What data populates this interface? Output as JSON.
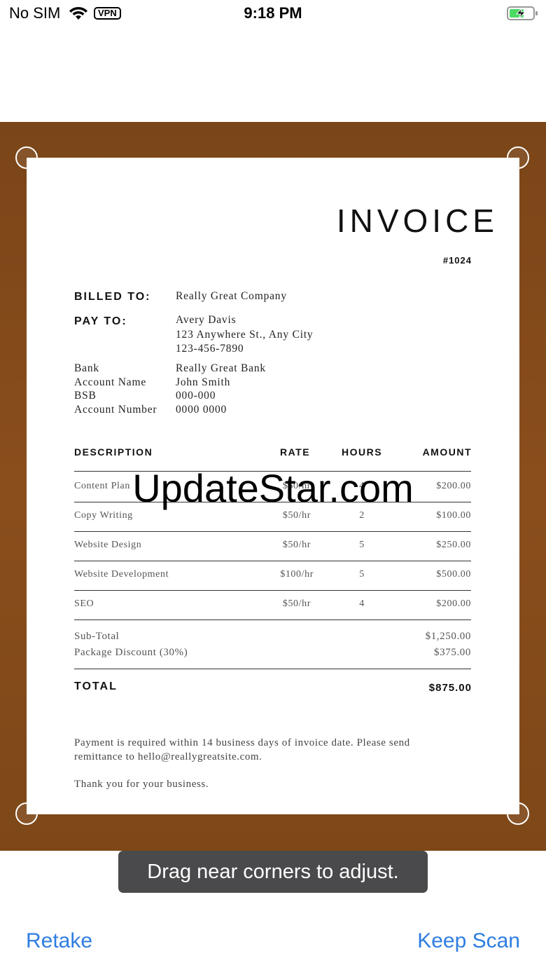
{
  "status_bar": {
    "carrier": "No SIM",
    "vpn": "VPN",
    "time": "9:18 PM",
    "battery_icon": "battery-charging-icon",
    "wifi_icon": "wifi-icon"
  },
  "invoice": {
    "title": "INVOICE",
    "number": "#1024",
    "billed_to_label": "BILLED TO:",
    "billed_to_value": "Really Great Company",
    "pay_to_label": "PAY TO:",
    "pay_to_name": "Avery Davis",
    "pay_to_address": "123 Anywhere St., Any City",
    "pay_to_phone": "123-456-7890",
    "bank_fields": [
      {
        "label": "Bank",
        "value": "Really Great Bank"
      },
      {
        "label": "Account Name",
        "value": "John Smith"
      },
      {
        "label": "BSB",
        "value": "000-000"
      },
      {
        "label": "Account Number",
        "value": "0000 0000"
      }
    ],
    "columns": [
      "DESCRIPTION",
      "RATE",
      "HOURS",
      "AMOUNT"
    ],
    "rows": [
      {
        "description": "Content Plan",
        "rate": "$50/hr",
        "hours": "4",
        "amount": "$200.00"
      },
      {
        "description": "Copy Writing",
        "rate": "$50/hr",
        "hours": "2",
        "amount": "$100.00"
      },
      {
        "description": "Website Design",
        "rate": "$50/hr",
        "hours": "5",
        "amount": "$250.00"
      },
      {
        "description": "Website Development",
        "rate": "$100/hr",
        "hours": "5",
        "amount": "$500.00"
      },
      {
        "description": "SEO",
        "rate": "$50/hr",
        "hours": "4",
        "amount": "$200.00"
      }
    ],
    "subtotal_label": "Sub-Total",
    "subtotal_value": "$1,250.00",
    "discount_label": "Package Discount (30%)",
    "discount_value": "$375.00",
    "total_label": "TOTAL",
    "total_value": "$875.00",
    "payment_note_line1": "Payment is required within 14 business days of invoice date. Please send",
    "payment_note_line2": "remittance to hello@reallygreatsite.com.",
    "thanks": "Thank you for your business."
  },
  "watermark": "UpdateStar.com",
  "toast": "Drag near corners to adjust.",
  "actions": {
    "retake": "Retake",
    "keep_scan": "Keep Scan"
  },
  "colors": {
    "accent": "#2f7de1",
    "scan_background": "#7a4518",
    "toast_background": "#4a4a4c"
  }
}
